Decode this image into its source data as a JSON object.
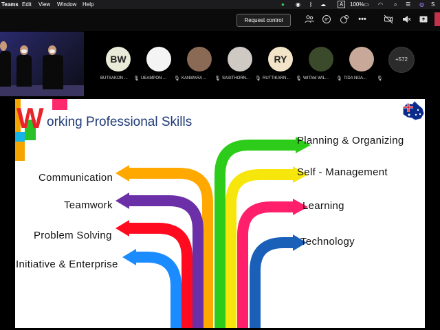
{
  "menubar": {
    "app": "Teams",
    "items": [
      "Edit",
      "View",
      "Window",
      "Help"
    ],
    "battery": "100%",
    "icons": [
      "onedrive-icon",
      "activity-icon",
      "bluetooth-icon",
      "cloud-icon",
      "dropbox-icon",
      "input-source-icon",
      "battery-icon",
      "wifi-icon",
      "spotlight-icon",
      "control-center-icon",
      "siri-icon"
    ]
  },
  "toolbar": {
    "request_control": "Request control",
    "icons": [
      "people-icon",
      "chat-icon",
      "reactions-icon",
      "more-icon",
      "camera-off-icon",
      "mic-off-icon",
      "share-icon",
      "hang-up-icon"
    ]
  },
  "participants": [
    {
      "initials": "BW",
      "name": "BUTSAKON ...",
      "color": "#e9ead8"
    },
    {
      "initials": "",
      "name": "UEAMPON ...",
      "color": "#f4f4f4"
    },
    {
      "initials": "",
      "name": "KANWARA ...",
      "color": "#8b6a55"
    },
    {
      "initials": "",
      "name": "SASITHORN...",
      "color": "#cfc9c4"
    },
    {
      "initials": "RY",
      "name": "RUTTIKARN...",
      "color": "#f2e4c8"
    },
    {
      "initials": "",
      "name": "WITAM WIL...",
      "color": "#3b4a2a"
    },
    {
      "initials": "",
      "name": "TIDA NGA...",
      "color": "#c8a898"
    }
  ],
  "more_participants": "+572",
  "slide": {
    "title_initial": "W",
    "title_rest": "orking Professional Skills",
    "left_skills": [
      "Communication",
      "Teamwork",
      "Problem Solving",
      "Initiative & Enterprise"
    ],
    "right_skills": [
      "Planning & Organizing",
      "Self - Management",
      "Learning",
      "Technology"
    ],
    "colors": {
      "orange": "#ffa900",
      "purple": "#6b2fa7",
      "red": "#ff0a1f",
      "blue": "#1a8cff",
      "green": "#2ecc1a",
      "yellow": "#f6e60c",
      "pink": "#ff1f6b",
      "navy": "#1a5fb8"
    }
  }
}
